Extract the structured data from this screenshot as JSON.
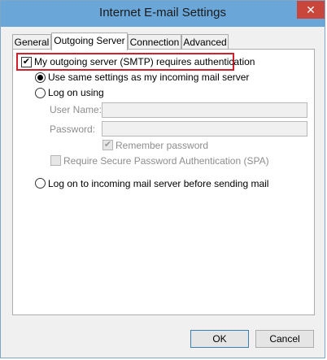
{
  "window": {
    "title": "Internet E-mail Settings",
    "close_glyph": "✕"
  },
  "tabs": [
    {
      "label": "General",
      "active": false
    },
    {
      "label": "Outgoing Server",
      "active": true
    },
    {
      "label": "Connection",
      "active": false
    },
    {
      "label": "Advanced",
      "active": false
    }
  ],
  "auth": {
    "requires_auth_label": "My outgoing server (SMTP) requires authentication",
    "requires_auth_checked": true,
    "use_same_label": "Use same settings as my incoming mail server",
    "use_same_selected": true,
    "log_on_using_label": "Log on using",
    "log_on_using_selected": false,
    "username_label": "User Name:",
    "username_value": "",
    "password_label": "Password:",
    "password_value": "",
    "remember_password_label": "Remember password",
    "remember_password_checked": true,
    "spa_label": "Require Secure Password Authentication (SPA)",
    "spa_checked": false,
    "log_on_incoming_label": "Log on to incoming mail server before sending mail",
    "log_on_incoming_selected": false
  },
  "buttons": {
    "ok": "OK",
    "cancel": "Cancel"
  },
  "check_glyph": "✔",
  "colors": {
    "titlebar": "#6aa7d8",
    "close": "#c9463d",
    "highlight": "#d1202b"
  }
}
